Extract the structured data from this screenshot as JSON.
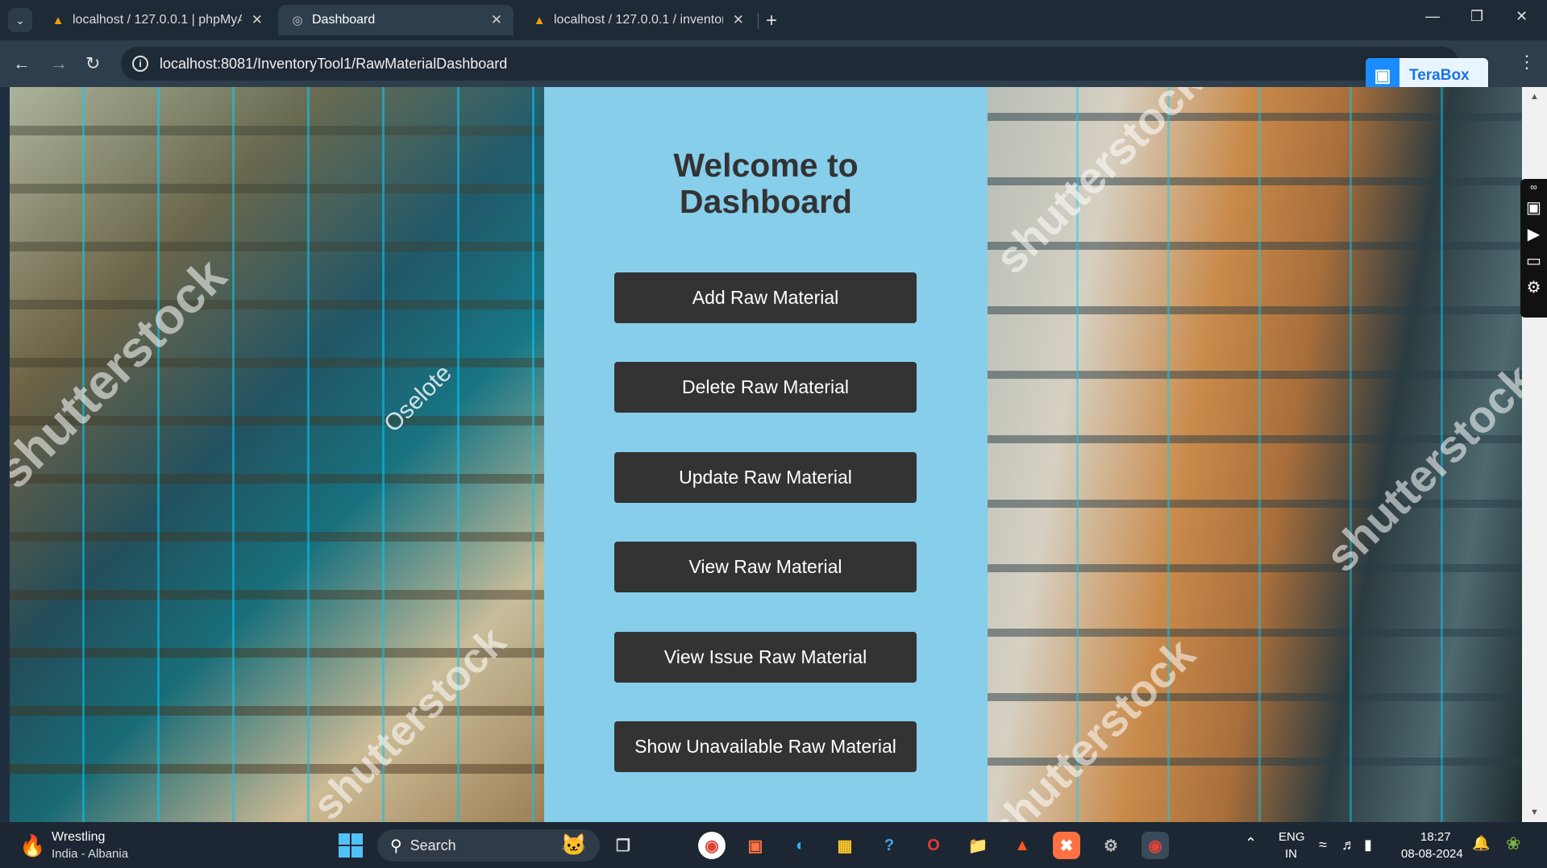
{
  "browser": {
    "tabs": [
      {
        "title": "localhost / 127.0.0.1 | phpMyAd",
        "icon": "phpmyadmin-icon",
        "active": false
      },
      {
        "title": "Dashboard",
        "icon": "globe-icon",
        "active": true
      },
      {
        "title": "localhost / 127.0.0.1 / inventory",
        "icon": "phpmyadmin-icon",
        "active": false
      }
    ],
    "new_tab_label": "+",
    "url": "localhost:8081/InventoryTool1/RawMaterialDashboard",
    "extension": {
      "label": "TeraBox"
    }
  },
  "dashboard": {
    "heading_line1": "Welcome to",
    "heading_line2": "Dashboard",
    "buttons": [
      {
        "label": "Add Raw Material"
      },
      {
        "label": "Delete Raw Material"
      },
      {
        "label": "Update Raw Material"
      },
      {
        "label": "View Raw Material"
      },
      {
        "label": "View Issue Raw Material"
      },
      {
        "label": "Show Unavailable Raw Material"
      }
    ],
    "panel_color": "#87ceeb",
    "button_color": "#333333"
  },
  "background_images": {
    "left_watermark": "shutterstock",
    "left_caption": "Oselote",
    "right_watermark": "shutterstock"
  },
  "taskbar": {
    "weather": {
      "title": "Wrestling",
      "subtitle": "India - Albania"
    },
    "search_label": "Search",
    "language": {
      "line1": "ENG",
      "line2": "IN"
    },
    "time": "18:27",
    "date": "08-08-2024"
  }
}
